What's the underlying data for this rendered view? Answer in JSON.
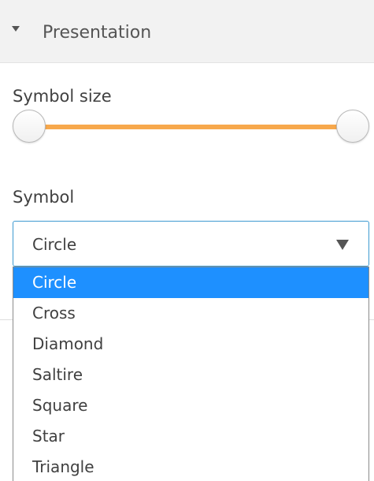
{
  "section": {
    "title": "Presentation",
    "expanded_icon": "caret-down-icon"
  },
  "symbol_size": {
    "label": "Symbol size",
    "range_low": 0,
    "range_high": 1,
    "track_color": "#f7a84c"
  },
  "symbol": {
    "label": "Symbol",
    "selected": "Circle",
    "arrow_icon": "dropdown-arrow-icon",
    "options": [
      "Circle",
      "Cross",
      "Diamond",
      "Saltire",
      "Square",
      "Star",
      "Triangle"
    ],
    "highlight_color": "#1e90ff"
  }
}
